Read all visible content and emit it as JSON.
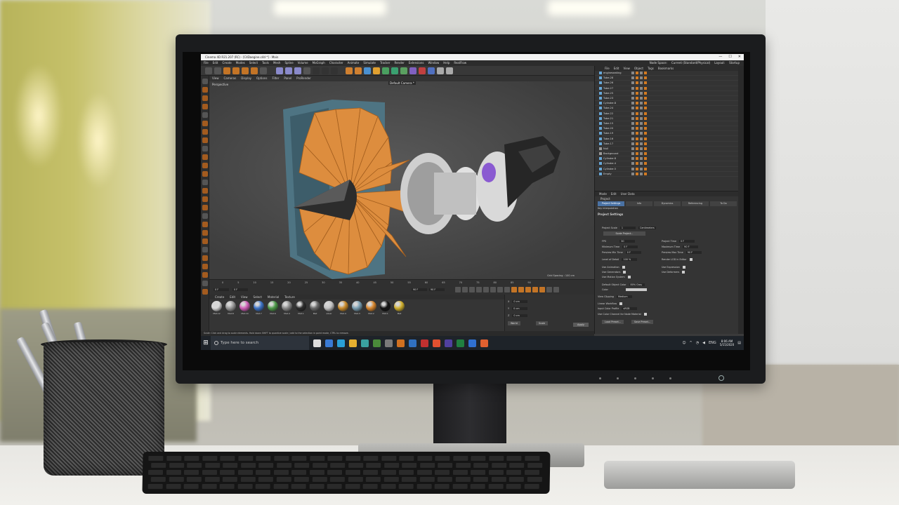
{
  "window": {
    "title": "Cinema 4D R21.207 (RC) - [C4Daegine.c4d *] - Main",
    "controls": [
      "—",
      "☐",
      "✕"
    ]
  },
  "menu": {
    "items": [
      "File",
      "Edit",
      "Create",
      "Modes",
      "Select",
      "Tools",
      "Mesh",
      "Spline",
      "Volume",
      "MoGraph",
      "Character",
      "Animate",
      "Simulate",
      "Tracker",
      "Render",
      "Extensions",
      "Window",
      "Help",
      "RealFlow"
    ],
    "node_space_label": "Node Space:",
    "node_space_value": "Current (Standard/Physical)",
    "layout_label": "Layout:",
    "layout_value": "Startup"
  },
  "viewport": {
    "menu": [
      "View",
      "Cameras",
      "Display",
      "Options",
      "Filter",
      "Panel",
      "ProRender"
    ],
    "label": "Perspective",
    "camera": "Default Camera *",
    "grid_spacing": "Grid Spacing : 100 cm"
  },
  "timeline": {
    "ticks": [
      "0",
      "5",
      "10",
      "15",
      "20",
      "25",
      "30",
      "35",
      "40",
      "45",
      "50",
      "55",
      "60",
      "65",
      "70",
      "75",
      "80",
      "85",
      "90"
    ],
    "start_field": "0 F",
    "current_field": "0 F",
    "end_field": "90 F",
    "end_field2": "90 F"
  },
  "materials": {
    "menu": [
      "Create",
      "Edit",
      "View",
      "Select",
      "Material",
      "Texture"
    ],
    "items": [
      {
        "name": "Mat.12",
        "color": "#d9d9d9"
      },
      {
        "name": "Mat.8",
        "color": "#9a9a9a"
      },
      {
        "name": "Mat.10",
        "color": "#d05fb8"
      },
      {
        "name": "Mat.7",
        "color": "#3d74c8"
      },
      {
        "name": "Mat.6",
        "color": "#4e9a4a"
      },
      {
        "name": "Mat.4",
        "color": "#8c8c8c"
      },
      {
        "name": "Mat.1",
        "color": "#2d2d2d"
      },
      {
        "name": "Mat",
        "color": "#6a6a6a"
      },
      {
        "name": "silver",
        "color": "#c3c3c3"
      },
      {
        "name": "Mat.4",
        "color": "#c98a2a"
      },
      {
        "name": "Mat.3",
        "color": "#7aa0b4"
      },
      {
        "name": "Mat.2",
        "color": "#d8862d"
      },
      {
        "name": "Mat.1",
        "color": "#151515"
      },
      {
        "name": "Mat",
        "color": "#d2b12e"
      }
    ]
  },
  "coords": {
    "apply": "Apply",
    "world": "World",
    "scale": "Scale"
  },
  "statusbar": "Scale: Click and drag to scale elements. Hold down SHIFT to quantize scale / add to the selection in point mode, CTRL to remove.",
  "objects": {
    "menu": [
      "File",
      "Edit",
      "View",
      "Object",
      "Tags",
      "Bookmarks"
    ],
    "rows": [
      "engineseating",
      "Tube.28",
      "Tube.26",
      "Tube.27",
      "Tube.25",
      "Tube.23",
      "Cylinder.8",
      "Tube.24",
      "Tube.22",
      "Tube.21",
      "Tube.15",
      "Tube.20",
      "Tube.19",
      "Tube.16",
      "Tube.17",
      "Null",
      "Background",
      "Cylinder.8",
      "Cylinder.4",
      "Cylinder.5",
      "Empty"
    ]
  },
  "attributes": {
    "menu": [
      "Mode",
      "Edit",
      "User Data"
    ],
    "header": "Project",
    "tabs": [
      "Project Settings",
      "Info",
      "Dynamics",
      "Referencing",
      "To Do"
    ],
    "sub": "Key Interpolation",
    "section": "Project Settings",
    "project_scale_label": "Project Scale",
    "project_scale_value": "1",
    "project_scale_unit": "Centimeters",
    "scale_project_btn": "Scale Project...",
    "fps_label": "FPS",
    "fps_value": "30",
    "project_time_label": "Project Time",
    "project_time_value": "0 F",
    "min_time_label": "Minimum Time",
    "min_time_value": "0 F",
    "max_time_label": "Maximum Time",
    "max_time_value": "90 F",
    "prev_min_label": "Preview Min Time",
    "prev_min_value": "0 F",
    "prev_max_label": "Preview Max Time",
    "prev_max_value": "90 F",
    "lod_label": "Level of Detail",
    "lod_value": "100 %",
    "render_lod_label": "Render LOD in Editor",
    "use_animation": "Use Animation",
    "use_expression": "Use Expression",
    "use_generators": "Use Generators",
    "use_deformers": "Use Deformers",
    "use_motion": "Use Motion System",
    "default_color_label": "Default Object Color",
    "default_color_value": "80% Gray",
    "color_label": "Color",
    "view_clipping_label": "View Clipping",
    "view_clipping_value": "Medium",
    "linear_workflow": "Linear Workflow",
    "input_color_label": "Input Color Profile",
    "input_color_value": "sRGB",
    "use_color_channel": "Use Color Channel for Node Material",
    "load_preset": "Load Preset...",
    "save_preset": "Save Preset..."
  },
  "taskbar": {
    "search_placeholder": "Type here to search",
    "tray_lang": "ENG",
    "time": "8:06 AM",
    "date": "5/15/2020"
  }
}
